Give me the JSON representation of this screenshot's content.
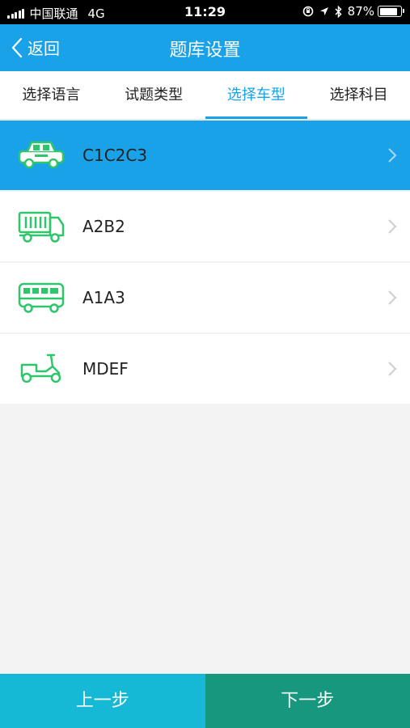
{
  "status_bar": {
    "carrier": "中国联通",
    "network": "4G",
    "time": "11:29",
    "battery": "87%",
    "battery_level": 0.87
  },
  "nav": {
    "back_label": "返回",
    "title": "题库设置"
  },
  "tabs": [
    {
      "label": "选择语言",
      "active": false
    },
    {
      "label": "试题类型",
      "active": false
    },
    {
      "label": "选择车型",
      "active": true
    },
    {
      "label": "选择科目",
      "active": false
    }
  ],
  "vehicles": [
    {
      "label": "C1C2C3",
      "icon": "car-icon",
      "selected": true
    },
    {
      "label": "A2B2",
      "icon": "truck-icon",
      "selected": false
    },
    {
      "label": "A1A3",
      "icon": "bus-icon",
      "selected": false
    },
    {
      "label": "MDEF",
      "icon": "scooter-icon",
      "selected": false
    }
  ],
  "buttons": {
    "prev": "上一步",
    "next": "下一步"
  },
  "colors": {
    "accent": "#1aa2e8",
    "icon_green": "#2fc56a",
    "prev_button": "#15b9d6",
    "next_button": "#16977e"
  }
}
